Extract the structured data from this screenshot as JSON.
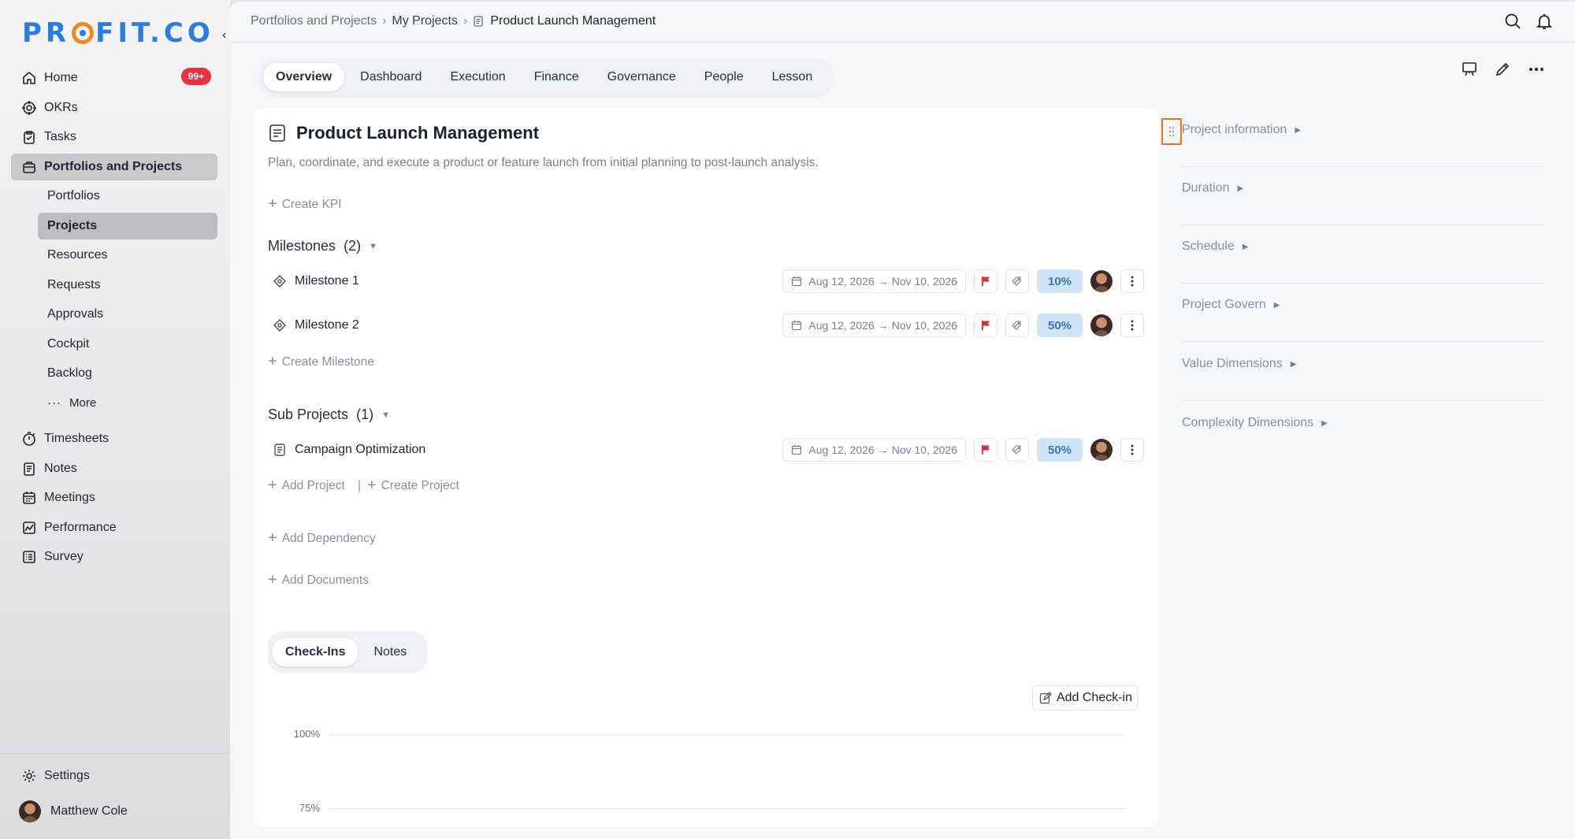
{
  "app": {
    "logo_text": "PROFIT.CO"
  },
  "sidebar": {
    "items": [
      {
        "label": "Home",
        "badge": "99+"
      },
      {
        "label": "OKRs"
      },
      {
        "label": "Tasks"
      },
      {
        "label": "Portfolios and Projects"
      }
    ],
    "sub_items": [
      "Portfolios",
      "Projects",
      "Resources",
      "Requests",
      "Approvals",
      "Cockpit",
      "Backlog",
      "More"
    ],
    "bottom_items": [
      "Timesheets",
      "Notes",
      "Meetings",
      "Performance",
      "Survey"
    ],
    "settings_label": "Settings",
    "user_name": "Matthew Cole"
  },
  "breadcrumb": {
    "level1": "Portfolios and Projects",
    "level2": "My Projects",
    "current": "Product Launch Management"
  },
  "tabs": [
    "Overview",
    "Dashboard",
    "Execution",
    "Finance",
    "Governance",
    "People",
    "Lesson"
  ],
  "project": {
    "title": "Product Launch Management",
    "description": "Plan, coordinate, and execute a product or feature launch from initial planning to post-launch analysis.",
    "create_kpi": "Create KPI"
  },
  "milestones": {
    "heading": "Milestones",
    "count": "(2)",
    "items": [
      {
        "name": "Milestone 1",
        "start": "Aug 12, 2026",
        "end": "Nov 10, 2026",
        "progress": "10%"
      },
      {
        "name": "Milestone 2",
        "start": "Aug 12, 2026",
        "end": "Nov 10, 2026",
        "progress": "50%"
      }
    ],
    "create_label": "Create Milestone"
  },
  "sub_projects": {
    "heading": "Sub Projects",
    "count": "(1)",
    "items": [
      {
        "name": "Campaign Optimization",
        "start": "Aug 12, 2026",
        "end": "Nov 10, 2026",
        "progress": "50%"
      }
    ],
    "add_label": "Add Project",
    "create_label": "Create Project"
  },
  "actions": {
    "add_dependency": "Add Dependency",
    "add_documents": "Add Documents"
  },
  "checkins": {
    "tabs": [
      "Check-Ins",
      "Notes"
    ],
    "add_label": "Add Check-in",
    "y_ticks": [
      "100%",
      "75%"
    ]
  },
  "right_panel": {
    "items": [
      "Project information",
      "Duration",
      "Schedule",
      "Project Govern",
      "Value Dimensions",
      "Complexity Dimensions"
    ]
  },
  "colors": {
    "accent_blue": "#2b7de0",
    "logo_orange": "#f08a1c",
    "badge_red": "#e8323c",
    "flag_red": "#e02a3a",
    "progress_bg": "#cfe4f5",
    "highlight_orange": "#f0701c"
  }
}
